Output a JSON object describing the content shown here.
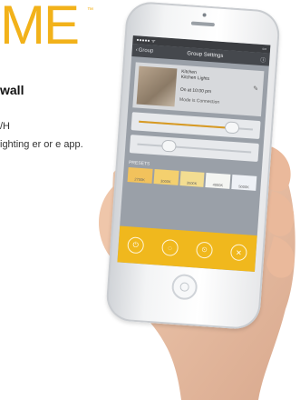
{
  "marketing": {
    "brand": "ME",
    "trademark": "™",
    "headline": "wall",
    "line1": "/H",
    "line2": "ighting er or e app."
  },
  "phone": {
    "status": {
      "left": "●●●●● ᯤ",
      "right": "▭"
    },
    "nav": {
      "back_label": "Group",
      "title": "Group Settings",
      "right_icon": "info-icon"
    },
    "group": {
      "name": "Kitchen",
      "info": "Kitchen Lights",
      "time": "On at 10:00 pm",
      "status": "Mode is Connection"
    },
    "sliders": [
      {
        "name": "brightness",
        "value": 0.82
      },
      {
        "name": "color-temperature",
        "value": 0.28
      }
    ],
    "presets_label": "PRESETS",
    "presets": [
      {
        "color": "#f2c25c",
        "label": "2700K"
      },
      {
        "color": "#f4d06e",
        "label": "3000K"
      },
      {
        "color": "#f3dd91",
        "label": "3500K"
      },
      {
        "color": "#f4f5f2",
        "label": "4000K"
      },
      {
        "color": "#eef1f6",
        "label": "5000K"
      }
    ],
    "actions": [
      {
        "name": "power-icon",
        "glyph": "⏻"
      },
      {
        "name": "bulb-icon",
        "glyph": "◌"
      },
      {
        "name": "timer-icon",
        "glyph": "⏲"
      },
      {
        "name": "scene-icon",
        "glyph": "✕"
      }
    ]
  },
  "colors": {
    "brand_gold": "#f2b21a",
    "action_bar": "#f0b81d"
  }
}
